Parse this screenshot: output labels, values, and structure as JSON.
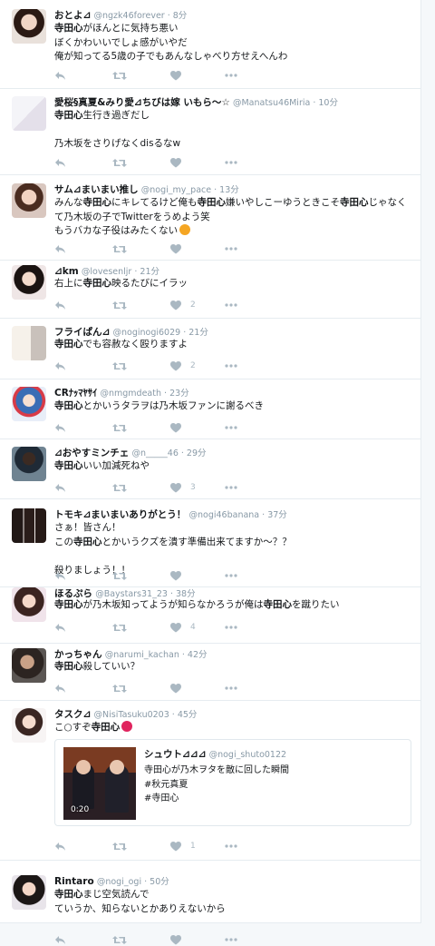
{
  "colors": {
    "name": "#14171a",
    "muted": "#8899a6",
    "icon": "#aab8c2",
    "border": "#e6ecf0",
    "like": "#aab8c2",
    "emoji_red": "#e0245e",
    "emoji_orange": "#f5a623"
  },
  "tweets": [
    {
      "name": "おとよ⊿",
      "handle": "@ngzk46forever",
      "time": "8分",
      "body": [
        "寺田心",
        "がほんとに気持ち悪い\nぼくかわいいでしょ感がいやだ\n俺が知ってる5歳の子でもあんなしゃべり方せえへんわ"
      ],
      "likes": ""
    },
    {
      "name": "愛桜§真夏&みり愛⊿ちびは嫁 いもら〜☆",
      "handle": "@Manatsu46Miria",
      "time": "10分",
      "body": [
        "寺田心",
        "生行き過ぎだし\n\n乃木坂をさりげなくdisるなw"
      ],
      "likes": ""
    },
    {
      "name": "サム⊿まいまい推し",
      "handle": "@nogi_my_pace",
      "time": "13分",
      "body": [
        "みんな",
        "寺田心",
        "にキレてるけど俺も",
        "寺田心",
        "嫌いやしこーゆうときこそ",
        "寺田心",
        "じゃなくて乃木坂の子でTwitterをうめよう笑\nもうバカな子役はみたくない"
      ],
      "likes": ""
    },
    {
      "name": "⊿km",
      "handle": "@lovesenljr",
      "time": "21分",
      "body": [
        "右上に",
        "寺田心",
        "映るたびにイラッ"
      ],
      "likes": "2"
    },
    {
      "name": "フライぱん⊿",
      "handle": "@noginogi6029",
      "time": "21分",
      "body": [
        "寺田心",
        "でも容赦なく殴りますよ"
      ],
      "likes": "2"
    },
    {
      "name": "CRﾅｯﾏﾔｻｲ",
      "handle": "@nmgmdeath",
      "time": "23分",
      "body": [
        "寺田心",
        "とかいうタラヲは乃木坂ファンに謝るべき"
      ],
      "likes": ""
    },
    {
      "name": "⊿おやすミンチェ",
      "handle": "@n_____46",
      "time": "29分",
      "body": [
        "寺田心",
        "いい加減死ねや"
      ],
      "likes": "3"
    },
    {
      "name": "トモキ⊿まいまいありがとう！",
      "handle": "@nogi46banana",
      "time": "37分",
      "body": [
        "さぁ！皆さん！\nこの",
        "寺田心",
        "とかいうクズを潰す準備出来てますか〜？？\n\n殺りましょう！！"
      ],
      "likes": ""
    },
    {
      "name": "ほるぷら",
      "handle": "@Baystars31_23",
      "time": "38分",
      "body": [
        "寺田心",
        "が乃木坂知ってようが知らなかろうが俺は",
        "寺田心",
        "を蹴りたい"
      ],
      "likes": "4"
    },
    {
      "name": "かっちゃん",
      "handle": "@narumi_kachan",
      "time": "42分",
      "body": [
        "寺田心",
        "殺していい？"
      ],
      "likes": ""
    },
    {
      "name": "タスク⊿",
      "handle": "@NisiTasuku0203",
      "time": "45分",
      "body": [
        "こ○すぞ",
        "寺田心"
      ],
      "likes": "1",
      "card": {
        "name": "シュウト⊿⊿⊿",
        "handle": "@nogi_shuto0122",
        "text": "寺田心が乃木ヲタを敵に回した瞬間\n#秋元真夏\n#寺田心",
        "duration": "0:20"
      }
    },
    {
      "name": "Rintaro",
      "handle": "@nogi_ogi",
      "time": "50分",
      "body": [
        "寺田心",
        "まじ空気読んで\nていうか、知らないとかありえないから"
      ],
      "likes": ""
    }
  ]
}
